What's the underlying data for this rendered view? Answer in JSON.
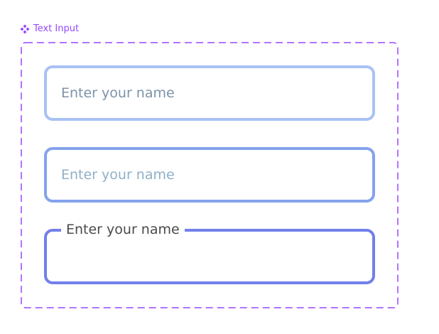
{
  "component": {
    "label": "Text Input",
    "icon": "component-icon",
    "frame_color": "#9747ff"
  },
  "fields": [
    {
      "state": "default",
      "placeholder": "Enter your name",
      "border_color": "#a9c1f5"
    },
    {
      "state": "hover",
      "placeholder": "Enter your name",
      "border_color": "#84a3ec"
    },
    {
      "state": "focused",
      "label": "Enter your name",
      "border_color": "#727feb"
    }
  ]
}
